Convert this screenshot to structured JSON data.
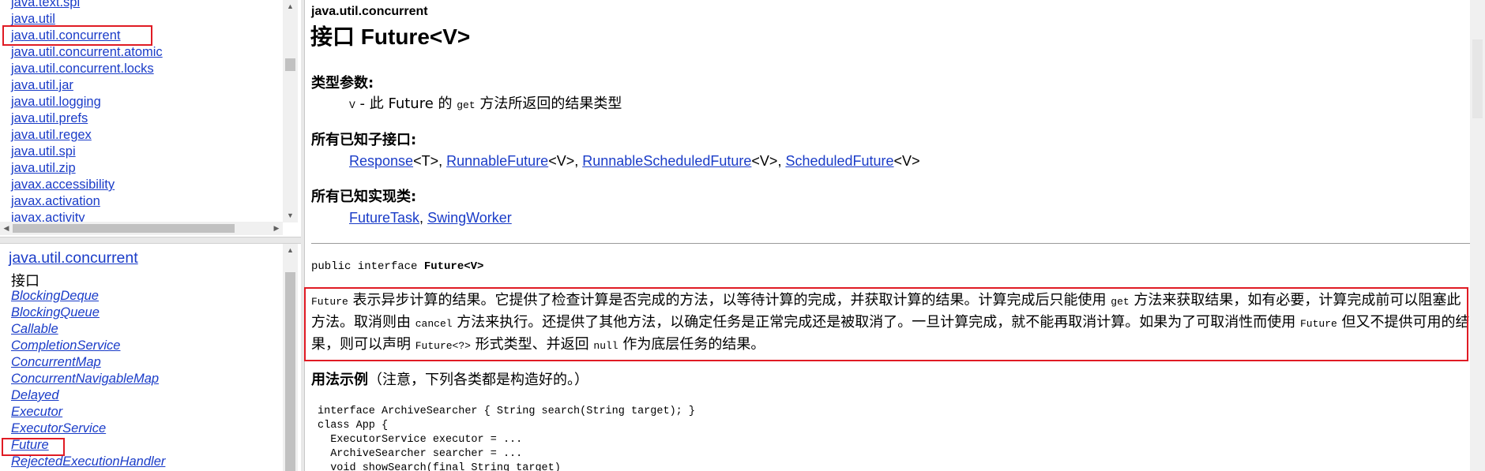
{
  "packages_frame": {
    "packages": [
      "java.text.spi",
      "java.util",
      "java.util.concurrent",
      "java.util.concurrent.atomic",
      "java.util.concurrent.locks",
      "java.util.jar",
      "java.util.logging",
      "java.util.prefs",
      "java.util.regex",
      "java.util.spi",
      "java.util.zip",
      "javax.accessibility",
      "javax.activation",
      "javax.activity"
    ],
    "highlighted": "java.util.concurrent"
  },
  "classes_frame": {
    "package_title": "java.util.concurrent",
    "interfaces_heading": "接口",
    "interfaces": [
      "BlockingDeque",
      "BlockingQueue",
      "Callable",
      "CompletionService",
      "ConcurrentMap",
      "ConcurrentNavigableMap",
      "Delayed",
      "Executor",
      "ExecutorService",
      "Future",
      "RejectedExecutionHandler"
    ],
    "highlighted": "Future"
  },
  "doc": {
    "package": "java.util.concurrent",
    "title_prefix": "接口",
    "title_name": "Future<V>",
    "type_params_label": "类型参数:",
    "type_param_name": "V",
    "type_param_desc_1": " - 此 Future 的 ",
    "type_param_code": "get",
    "type_param_desc_2": " 方法所返回的结果类型",
    "subinterfaces_label": "所有已知子接口:",
    "subinterfaces": [
      {
        "name": "Response",
        "generic": "<T>"
      },
      {
        "name": "RunnableFuture",
        "generic": "<V>"
      },
      {
        "name": "RunnableScheduledFuture",
        "generic": "<V>"
      },
      {
        "name": "ScheduledFuture",
        "generic": "<V>"
      }
    ],
    "implementing_label": "所有已知实现类:",
    "implementing": [
      "FutureTask",
      "SwingWorker"
    ],
    "signature_prefix": "public interface ",
    "signature_name": "Future<V>",
    "description": [
      {
        "t": "code",
        "v": "Future"
      },
      {
        "t": "text",
        "v": " 表示异步计算的结果。它提供了检查计算是否完成的方法，以等待计算的完成，并获取计算的结果。计算完成后只能使用 "
      },
      {
        "t": "code",
        "v": "get"
      },
      {
        "t": "text",
        "v": " 方法来获取结果，如有必要，计算完成前可以阻塞此方法。取消则由 "
      },
      {
        "t": "code",
        "v": "cancel"
      },
      {
        "t": "text",
        "v": " 方法来执行。还提供了其他方法，以确定任务是正常完成还是被取消了。一旦计算完成，就不能再取消计算。如果为了可取消性而使用 "
      },
      {
        "t": "code",
        "v": "Future"
      },
      {
        "t": "text",
        "v": " 但又不提供可用的结果，则可以声明 "
      },
      {
        "t": "code",
        "v": "Future<?>"
      },
      {
        "t": "text",
        "v": " 形式类型、并返回 "
      },
      {
        "t": "code",
        "v": "null"
      },
      {
        "t": "text",
        "v": " 作为底层任务的结果。"
      }
    ],
    "usage_label": "用法示例",
    "usage_note": "（注意，下列各类都是构造好的。）",
    "code_lines": [
      "interface ArchiveSearcher { String search(String target); }",
      "class App {",
      "  ExecutorService executor = ...",
      "  ArchiveSearcher searcher = ...",
      "  void showSearch(final String target)"
    ]
  }
}
